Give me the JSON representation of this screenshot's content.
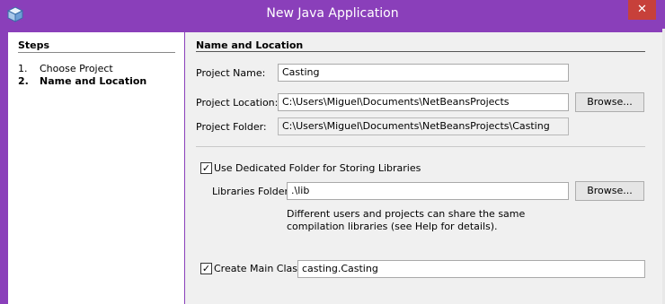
{
  "window": {
    "title": "New Java Application",
    "close_glyph": "✕",
    "icon": "netbeans-cube-icon"
  },
  "steps": {
    "heading": "Steps",
    "items": [
      {
        "num": "1.",
        "label": "Choose Project"
      },
      {
        "num": "2.",
        "label": "Name and Location"
      }
    ]
  },
  "section": {
    "heading": "Name and Location"
  },
  "project_name": {
    "label": "Project Name:",
    "value": "Casting"
  },
  "project_location": {
    "label": "Project Location:",
    "value": "C:\\Users\\Miguel\\Documents\\NetBeansProjects",
    "browse": "Browse..."
  },
  "project_folder": {
    "label": "Project Folder:",
    "value": "C:\\Users\\Miguel\\Documents\\NetBeansProjects\\Casting"
  },
  "dedicated_folder": {
    "label": "Use Dedicated Folder for Storing Libraries",
    "checked": true
  },
  "libraries_folder": {
    "label": "Libraries Folder:",
    "value": ".\\lib",
    "browse": "Browse..."
  },
  "help_text": "Different users and projects can share the same compilation libraries (see Help for details).",
  "main_class": {
    "label": "Create Main Class",
    "checked": true,
    "value": "casting.Casting"
  },
  "check_glyph": "✓",
  "colors": {
    "titlebar": "#8a3fba",
    "close": "#c7403a"
  }
}
